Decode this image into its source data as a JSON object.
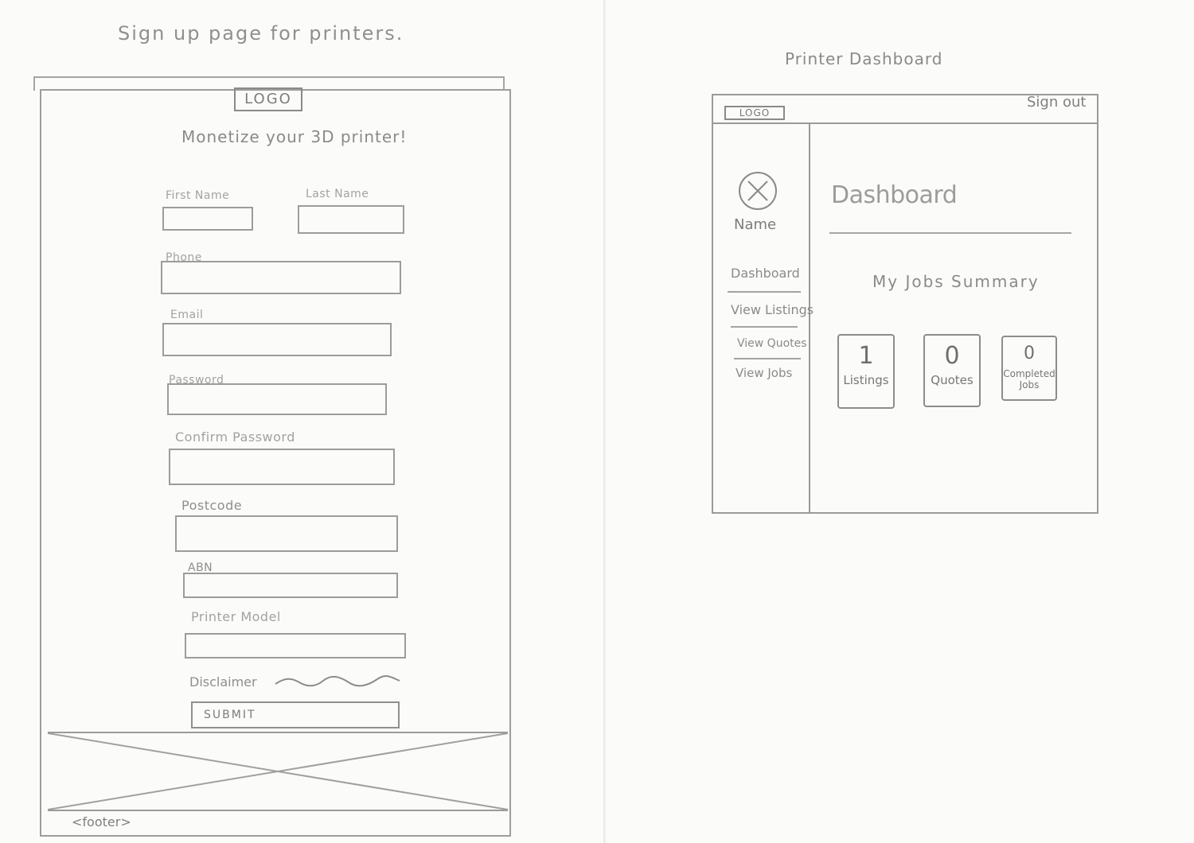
{
  "captions": {
    "signup": "Sign up page for printers.",
    "dashboard": "Printer Dashboard"
  },
  "signup": {
    "logo": "LOGO",
    "tagline": "Monetize your 3D printer!",
    "fields": {
      "first_name": "First Name",
      "last_name": "Last Name",
      "phone": "Phone",
      "email": "Email",
      "password": "Password",
      "confirm_password": "Confirm Password",
      "postcode": "Postcode",
      "abn": "ABN",
      "printer_model": "Printer Model"
    },
    "disclaimer": "Disclaimer",
    "submit": "SUBMIT",
    "footer": "<footer>"
  },
  "dashboard": {
    "logo": "LOGO",
    "sign_out": "Sign out",
    "user_name": "Name",
    "nav": [
      "Dashboard",
      "View Listings",
      "View Quotes",
      "View Jobs"
    ],
    "title": "Dashboard",
    "summary_title": "My Jobs Summary",
    "stats": [
      {
        "value": "1",
        "label": "Listings"
      },
      {
        "value": "0",
        "label": "Quotes"
      },
      {
        "value": "0",
        "label": "Completed Jobs"
      }
    ]
  }
}
